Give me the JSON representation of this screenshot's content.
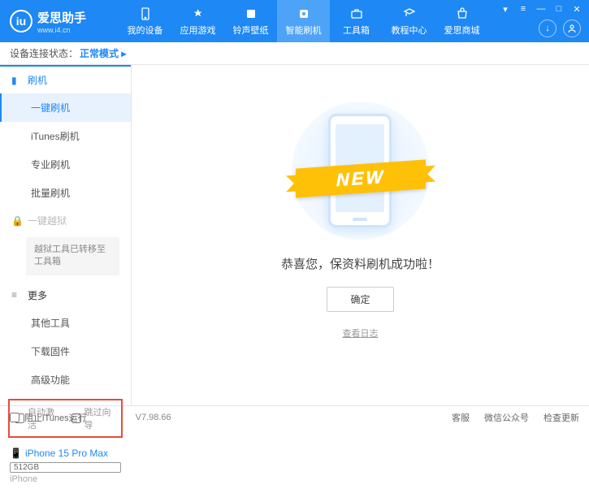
{
  "logo": {
    "name": "爱思助手",
    "url": "www.i4.cn",
    "badge": "iu"
  },
  "nav": [
    {
      "label": "我的设备"
    },
    {
      "label": "应用游戏"
    },
    {
      "label": "铃声壁纸"
    },
    {
      "label": "智能刷机"
    },
    {
      "label": "工具箱"
    },
    {
      "label": "教程中心"
    },
    {
      "label": "爱思商城"
    }
  ],
  "status": {
    "label": "设备连接状态：",
    "value": "正常模式"
  },
  "sidebar": {
    "flash": {
      "title": "刷机",
      "items": [
        "一键刷机",
        "iTunes刷机",
        "专业刷机",
        "批量刷机"
      ]
    },
    "jailbreak": {
      "title": "一键越狱",
      "note": "越狱工具已转移至工具箱"
    },
    "more": {
      "title": "更多",
      "items": [
        "其他工具",
        "下载固件",
        "高级功能"
      ]
    }
  },
  "checkboxes": {
    "auto_activate": "自动激活",
    "skip_guide": "跳过向导"
  },
  "device": {
    "name": "iPhone 15 Pro Max",
    "storage": "512GB",
    "model": "iPhone"
  },
  "content": {
    "ribbon": "NEW",
    "message": "恭喜您，保资料刷机成功啦！",
    "ok": "确定",
    "log": "查看日志"
  },
  "footer": {
    "block_itunes": "阻止iTunes运行",
    "version": "V7.98.66",
    "support": "客服",
    "wechat": "微信公众号",
    "update": "检查更新"
  }
}
